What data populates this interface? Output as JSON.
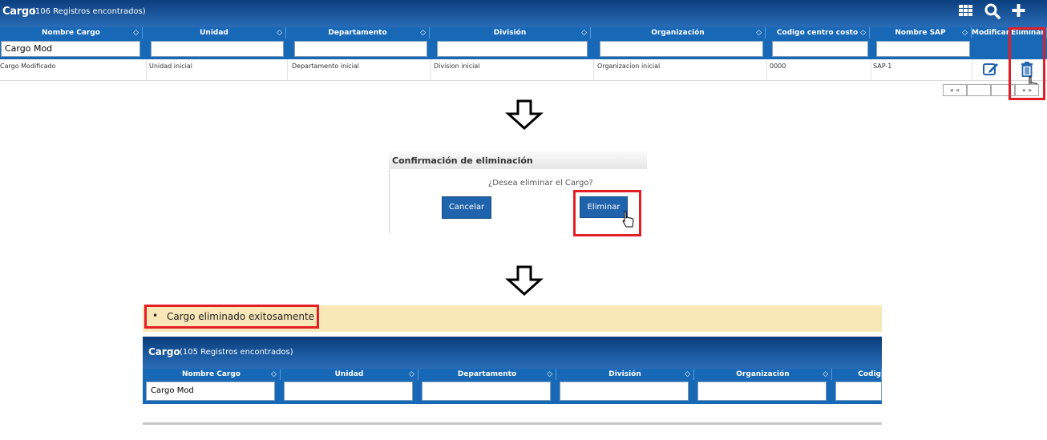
{
  "top": {
    "title": "Cargo",
    "count": "(106 Registros encontrados)",
    "columns": [
      "Nombre Cargo",
      "Unidad",
      "Departamento",
      "División",
      "Organización",
      "Codigo centro costo",
      "Nombre SAP",
      "Modificar",
      "Eliminar"
    ],
    "filter_name": "Cargo Mod",
    "row": [
      "Cargo Modificado",
      "Unidad inicial",
      "Departamento inicial",
      "Division inicial",
      "Organizacion inicial",
      "0000",
      "SAP-1"
    ],
    "pager": {
      "first": "« «",
      "last": "» »"
    }
  },
  "dialog": {
    "title": "Confirmación de eliminación",
    "question": "¿Desea eliminar el Cargo?",
    "cancel": "Cancelar",
    "confirm": "Eliminar"
  },
  "bottom": {
    "message": "Cargo eliminado exitosamente",
    "title": "Cargo",
    "count": "(105 Registros encontrados)",
    "columns": [
      "Nombre Cargo",
      "Unidad",
      "Departamento",
      "División",
      "Organización",
      "Codig"
    ],
    "filter_name": "Cargo Mod"
  },
  "colors": {
    "header": "#1868b8",
    "highlight": "#e41e26",
    "message_bg": "#f8e8b8"
  },
  "icons": [
    "grid-icon",
    "search-icon",
    "plus-icon",
    "edit-icon",
    "trash-icon",
    "hand-cursor-icon",
    "down-arrow-icon"
  ]
}
